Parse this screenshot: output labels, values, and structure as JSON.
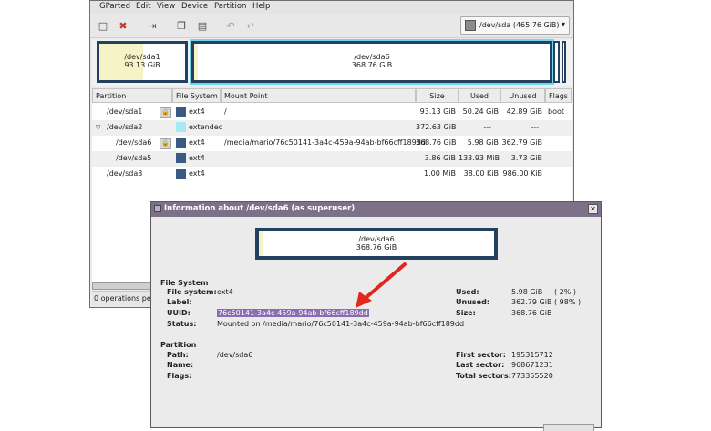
{
  "menu": [
    "GParted",
    "Edit",
    "View",
    "Device",
    "Partition",
    "Help"
  ],
  "toolbar_icons": [
    "new-icon",
    "delete-icon",
    "resize-icon",
    "copy-icon",
    "paste-icon",
    "undo-icon",
    "apply-icon"
  ],
  "device_selector": {
    "label": "/dev/sda   (465.76 GiB)"
  },
  "disk_map": {
    "sda1": {
      "name": "/dev/sda1",
      "size": "93.13 GiB"
    },
    "sda6": {
      "name": "/dev/sda6",
      "size": "368.76 GiB"
    }
  },
  "table": {
    "headers": [
      "Partition",
      "File System",
      "Mount Point",
      "Size",
      "Used",
      "Unused",
      "Flags"
    ],
    "rows": [
      {
        "partition": "/dev/sda1",
        "fs": "ext4",
        "mount": "/",
        "size": "93.13 GiB",
        "used": "50.24 GiB",
        "unused": "42.89 GiB",
        "flags": "boot",
        "color": "#3b5a7f"
      },
      {
        "partition": "/dev/sda2",
        "fs": "extended",
        "mount": "",
        "size": "372.63 GiB",
        "used": "---",
        "unused": "---",
        "flags": "",
        "color": "#a6eaf6"
      },
      {
        "partition": "/dev/sda6",
        "fs": "ext4",
        "mount": "/media/mario/76c50141-3a4c-459a-94ab-bf66cff189dd",
        "size": "368.76 GiB",
        "used": "5.98 GiB",
        "unused": "362.79 GiB",
        "flags": "",
        "color": "#3b5a7f"
      },
      {
        "partition": "/dev/sda5",
        "fs": "ext4",
        "mount": "",
        "size": "3.86 GiB",
        "used": "133.93 MiB",
        "unused": "3.73 GiB",
        "flags": "",
        "color": "#3b5a7f"
      },
      {
        "partition": "/dev/sda3",
        "fs": "ext4",
        "mount": "",
        "size": "1.00 MiB",
        "used": "38.00 KiB",
        "unused": "986.00 KiB",
        "flags": "",
        "color": "#3b5a7f"
      }
    ]
  },
  "status": "0 operations pen",
  "dialog": {
    "title": "Information about /dev/sda6 (as superuser)",
    "partition_name": "/dev/sda6",
    "partition_size": "368.76 GiB",
    "fs_section": "File System",
    "fs_labels": {
      "filesystem": "File system:",
      "label": "Label:",
      "uuid": "UUID:",
      "status": "Status:"
    },
    "fs_values": {
      "filesystem": "ext4",
      "label": "",
      "uuid": "76c50141-3a4c-459a-94ab-bf66cff189dd",
      "status": "Mounted on /media/mario/76c50141-3a4c-459a-94ab-bf66cff189dd"
    },
    "usage_labels": {
      "used": "Used:",
      "unused": "Unused:",
      "size": "Size:"
    },
    "usage_values": {
      "used": "5.98 GiB",
      "used_pct": "( 2% )",
      "unused": "362.79 GiB",
      "unused_pct": "( 98% )",
      "size": "368.76 GiB"
    },
    "part_section": "Partition",
    "part_labels": {
      "path": "Path:",
      "name": "Name:",
      "flags": "Flags:"
    },
    "part_values": {
      "path": "/dev/sda6"
    },
    "sector_labels": {
      "first": "First sector:",
      "last": "Last sector:",
      "total": "Total sectors:"
    },
    "sector_values": {
      "first": "195315712",
      "last": "968671231",
      "total": "773355520"
    }
  },
  "colors": {
    "partition_border": "#24405f",
    "dialog_title": "#7d7189",
    "uuid_highlight": "#8b6cb0",
    "arrow": "#e0281e"
  }
}
